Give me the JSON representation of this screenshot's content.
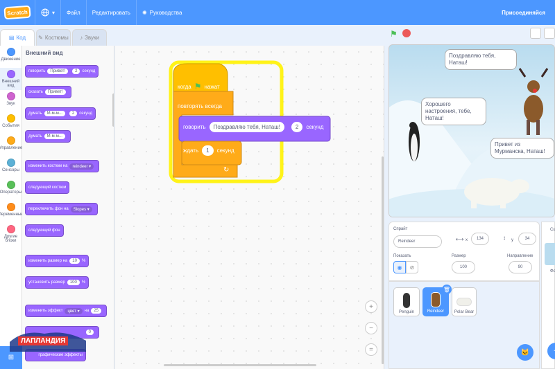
{
  "topbar": {
    "logo": "Scratch",
    "file": "Файл",
    "edit": "Редактировать",
    "tutorials": "Руководства",
    "signin": "Присоединяйся"
  },
  "tabs": {
    "code": "Код",
    "costumes": "Костюмы",
    "sounds": "Звуки"
  },
  "categories": [
    {
      "label": "Движение",
      "color": "#4c97ff"
    },
    {
      "label": "Внешний вид",
      "color": "#9966ff"
    },
    {
      "label": "Звук",
      "color": "#cf63cf"
    },
    {
      "label": "События",
      "color": "#ffbf00"
    },
    {
      "label": "Управление",
      "color": "#ffab19"
    },
    {
      "label": "Сенсоры",
      "color": "#5cb1d6"
    },
    {
      "label": "Операторы",
      "color": "#59c059"
    },
    {
      "label": "Переменные",
      "color": "#ff8c1a"
    },
    {
      "label": "Другие блоки",
      "color": "#ff6680"
    }
  ],
  "palette": {
    "title": "Внешний вид",
    "say_secs": {
      "a": "говорить",
      "msg": "Привет!",
      "n": "2",
      "b": "секунд"
    },
    "say": {
      "a": "сказать",
      "msg": "Привет!"
    },
    "think_secs": {
      "a": "думать",
      "msg": "М-м-м...",
      "n": "2",
      "b": "секунд"
    },
    "think": {
      "a": "думать",
      "msg": "М-м-м..."
    },
    "switch_costume": {
      "a": "изменить костюм на",
      "val": "reindeer ▾"
    },
    "next_costume": "следующий костюм",
    "switch_backdrop": {
      "a": "переключить фон на",
      "val": "Slopes ▾"
    },
    "next_backdrop": "следующий фон",
    "change_size": {
      "a": "изменить размер на",
      "n": "10",
      "b": "%"
    },
    "set_size": {
      "a": "установить размер",
      "n": "100",
      "b": "%"
    },
    "change_effect": {
      "a": "изменить эффект",
      "val": "цвет ▾",
      "b": "на",
      "n": "25"
    },
    "set_effect": {
      "n": "0"
    },
    "clear_effects": "графические эффекты"
  },
  "script": {
    "when_flag_a": "когда",
    "when_flag_b": "нажат",
    "forever": "повторять всегда",
    "say_a": "говорить",
    "say_msg": "Поздравляю тебя, Наташ!",
    "say_n": "2",
    "say_b": "секунд",
    "wait_a": "ждать",
    "wait_n": "1",
    "wait_b": "секунд"
  },
  "stage": {
    "bubble1": "Поздравляю тебя, Наташ!",
    "bubble2": "Хорошего настроения, тебе, Наташ!",
    "bubble3": "Привет из Мурманска, Наташ!"
  },
  "sprite_info": {
    "sprite_label": "Спрайт",
    "sprite_name": "Reindeer",
    "x_label": "x",
    "x": "134",
    "y_label": "y",
    "y": "34",
    "show_label": "Показать",
    "size_label": "Размер",
    "size": "100",
    "direction_label": "Направление",
    "direction": "90"
  },
  "sprites": [
    "Penguin",
    "Reindeer",
    "Polar Bear"
  ],
  "backdrop_panel": {
    "label_a": "Сц",
    "label_b": "Фо"
  },
  "watermark": "ЛАПЛАНДИЯ",
  "colors": {
    "accent": "#4c97ff",
    "looks": "#9966ff",
    "control": "#ffab19",
    "events": "#ffbf00"
  }
}
